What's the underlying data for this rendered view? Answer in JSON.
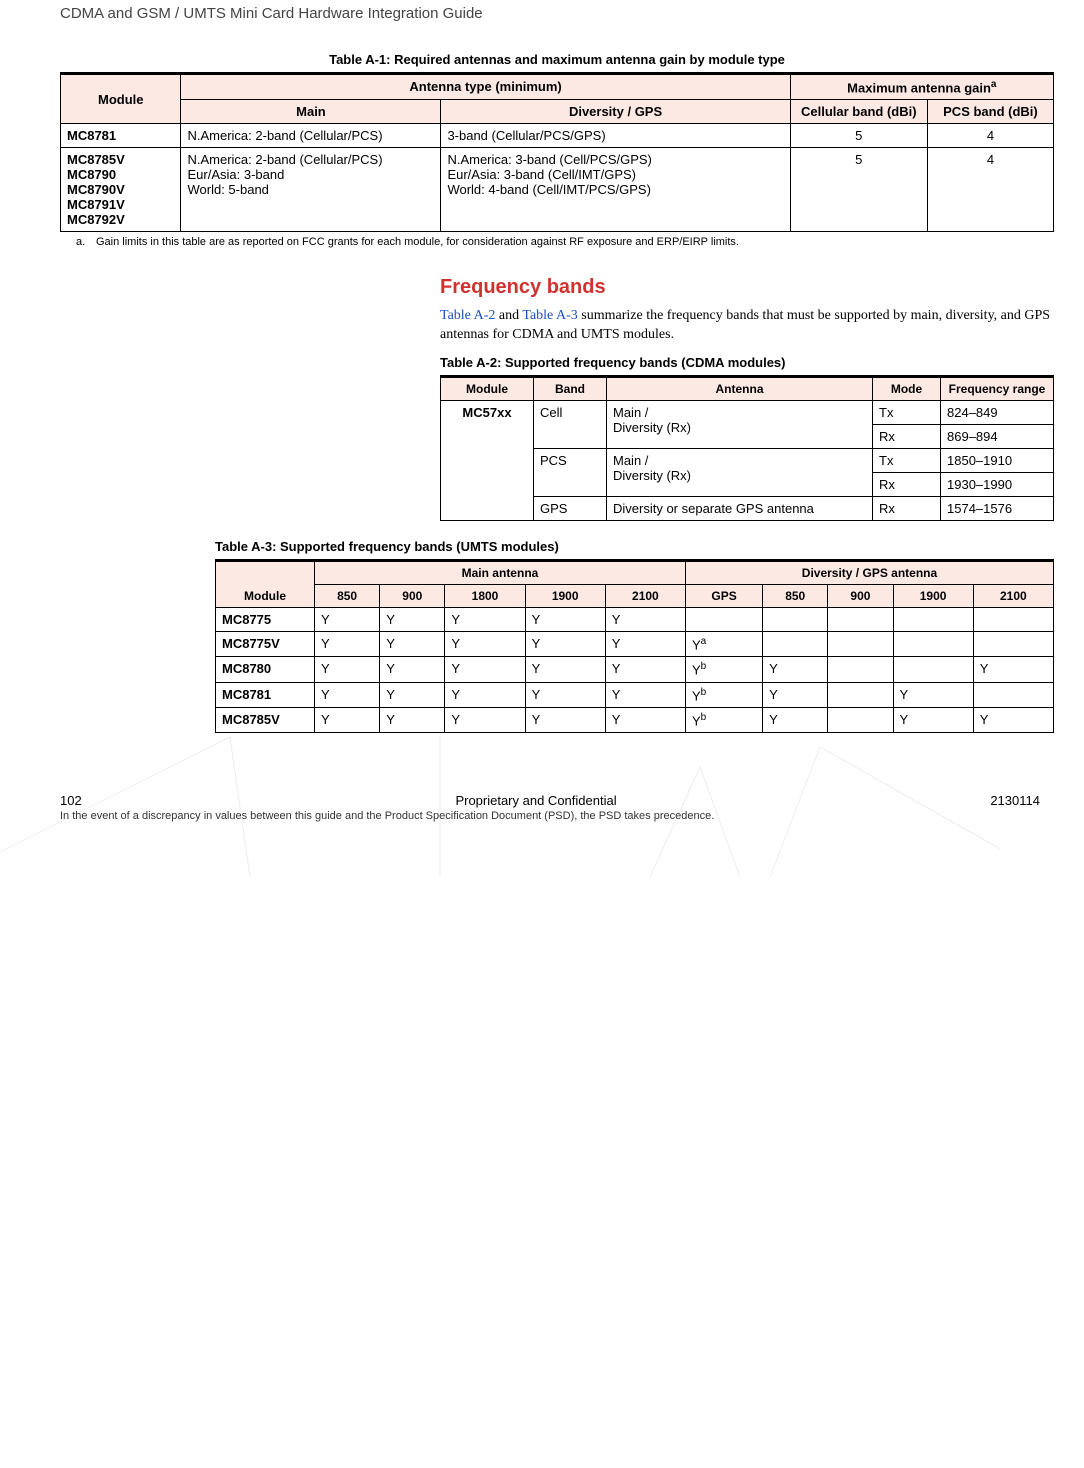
{
  "header": "CDMA and GSM / UMTS Mini Card Hardware Integration Guide",
  "tableA1": {
    "caption": "Table A-1:  Required antennas and maximum antenna gain by module type",
    "col_module": "Module",
    "group_antenna": "Antenna type (minimum)",
    "group_maxgain_html": "Maximum antenna gain",
    "group_maxgain_sup": "a",
    "col_main": "Main",
    "col_diversity": "Diversity / GPS",
    "col_cell": "Cellular band (dBi)",
    "col_pcs": "PCS band (dBi)",
    "rows": [
      {
        "module": "MC8781",
        "main": "N.America: 2-band (Cellular/PCS)",
        "div": "3-band (Cellular/PCS/GPS)",
        "cell": "5",
        "pcs": "4"
      },
      {
        "module": "MC8785V\nMC8790\nMC8790V\nMC8791V\nMC8792V",
        "main": "N.America: 2-band (Cellular/PCS)\nEur/Asia: 3-band\nWorld: 5-band",
        "div": "N.America: 3-band (Cell/PCS/GPS)\nEur/Asia: 3-band (Cell/IMT/GPS)\nWorld: 4-band (Cell/IMT/PCS/GPS)",
        "cell": "5",
        "pcs": "4"
      }
    ],
    "footnote_label": "a.",
    "footnote": "Gain limits in this table are as reported on FCC grants for each module, for consideration against RF exposure and ERP/EIRP limits."
  },
  "section": {
    "heading": "Frequency bands",
    "para_pre": "",
    "link1": "Table A-2",
    "mid1": " and ",
    "link2": "Table A-3",
    "post": " summarize the frequency bands that must be supported by main, diversity, and GPS antennas for CDMA and UMTS modules."
  },
  "tableA2": {
    "caption": "Table A-2:  Supported frequency bands (CDMA modules)",
    "col_module": "Module",
    "col_band": "Band",
    "col_antenna": "Antenna",
    "col_mode": "Mode",
    "col_freq": "Frequency range",
    "module": "MC57xx",
    "rows": [
      {
        "band": "Cell",
        "antenna": "Main /\nDiversity (Rx)",
        "mode": "Tx",
        "freq": "824–849"
      },
      {
        "band": "",
        "antenna": "",
        "mode": "Rx",
        "freq": "869–894"
      },
      {
        "band": "PCS",
        "antenna": "Main /\nDiversity (Rx)",
        "mode": "Tx",
        "freq": "1850–1910"
      },
      {
        "band": "",
        "antenna": "",
        "mode": "Rx",
        "freq": "1930–1990"
      },
      {
        "band": "GPS",
        "antenna": "Diversity or separate GPS antenna",
        "mode": "Rx",
        "freq": "1574–1576"
      }
    ]
  },
  "tableA3": {
    "caption": "Table A-3:  Supported frequency bands (UMTS modules)",
    "col_module": "Module",
    "group_main": "Main antenna",
    "group_div": "Diversity / GPS antenna",
    "cols_main": [
      "850",
      "900",
      "1800",
      "1900",
      "2100"
    ],
    "cols_div": [
      "GPS",
      "850",
      "900",
      "1900",
      "2100"
    ],
    "rows": [
      {
        "module": "MC8775",
        "m": [
          "Y",
          "Y",
          "Y",
          "Y",
          "Y"
        ],
        "d": [
          "",
          "",
          "",
          "",
          ""
        ]
      },
      {
        "module": "MC8775V",
        "m": [
          "Y",
          "Y",
          "Y",
          "Y",
          "Y"
        ],
        "d": [
          "Y",
          "",
          "",
          "",
          ""
        ],
        "dsup": [
          "a",
          "",
          "",
          "",
          ""
        ]
      },
      {
        "module": "MC8780",
        "m": [
          "Y",
          "Y",
          "Y",
          "Y",
          "Y"
        ],
        "d": [
          "Y",
          "Y",
          "",
          "",
          "Y"
        ],
        "dsup": [
          "b",
          "",
          "",
          "",
          ""
        ]
      },
      {
        "module": "MC8781",
        "m": [
          "Y",
          "Y",
          "Y",
          "Y",
          "Y"
        ],
        "d": [
          "Y",
          "Y",
          "",
          "Y",
          ""
        ],
        "dsup": [
          "b",
          "",
          "",
          "",
          ""
        ]
      },
      {
        "module": "MC8785V",
        "m": [
          "Y",
          "Y",
          "Y",
          "Y",
          "Y"
        ],
        "d": [
          "Y",
          "Y",
          "",
          "Y",
          "Y"
        ],
        "dsup": [
          "b",
          "",
          "",
          "",
          ""
        ]
      }
    ]
  },
  "footer": {
    "page": "102",
    "center": "Proprietary and Confidential",
    "right": "2130114",
    "note": "In the event of a discrepancy in values between this guide and the Product Specification Document (PSD), the PSD takes precedence."
  }
}
